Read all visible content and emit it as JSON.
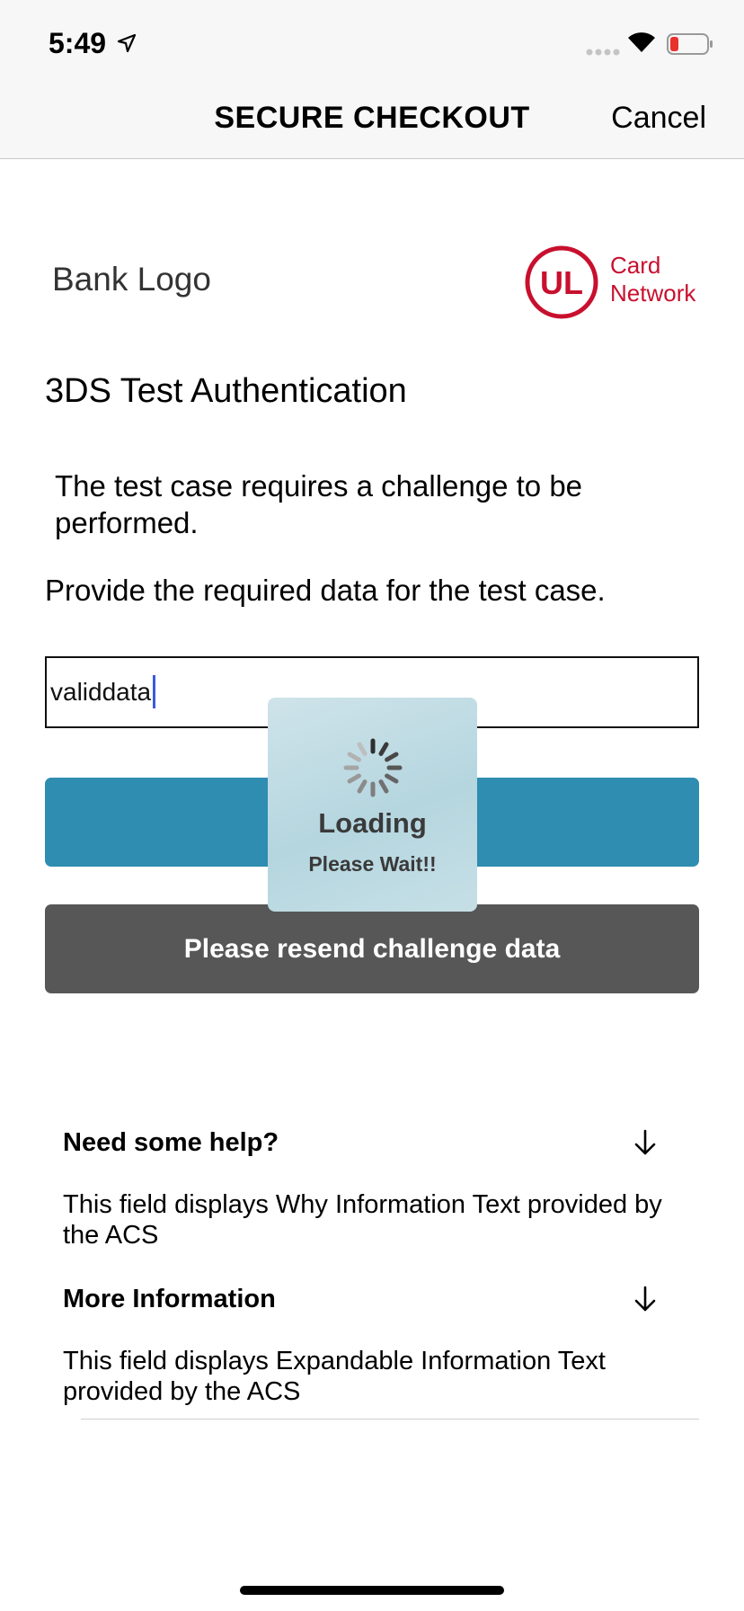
{
  "status_bar": {
    "time": "5:49",
    "icons": [
      "location-arrow-icon",
      "signal-icon",
      "wifi-icon",
      "battery-icon"
    ]
  },
  "nav": {
    "title": "SECURE CHECKOUT",
    "cancel_label": "Cancel"
  },
  "branding": {
    "bank_logo_text": "Bank Logo",
    "card_network_line1": "Card",
    "card_network_line2": "Network",
    "card_network_logo_text": "UL",
    "brand_color": "#c8102e"
  },
  "challenge": {
    "heading": "3DS Test Authentication",
    "info_text": "The test case requires a challenge to be performed.",
    "label_text": "Provide the required data for the test case.",
    "input_value": "validdata",
    "submit_label": "",
    "resend_label": "Please resend challenge data"
  },
  "loading": {
    "title": "Loading",
    "subtitle": "Please Wait!!"
  },
  "help": {
    "title": "Need some help?",
    "text": "This field displays Why Information Text provided by the ACS"
  },
  "more_info": {
    "title": "More Information",
    "text": "This field displays Expandable Information Text provided by the ACS"
  },
  "colors": {
    "submit_button": "#2e8db0",
    "resend_button": "#575757",
    "caret": "#3b5bdb"
  }
}
